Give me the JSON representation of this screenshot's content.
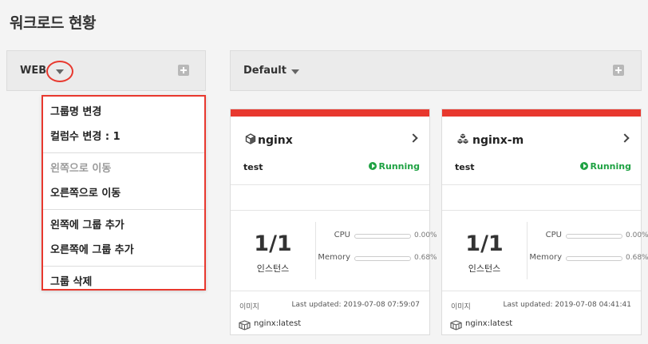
{
  "page": {
    "title": "워크로드 현황"
  },
  "groups": [
    {
      "name": "WEB"
    },
    {
      "name": "Default"
    }
  ],
  "menu": {
    "sections": [
      [
        {
          "label": "그룹명 변경",
          "disabled": false
        },
        {
          "label": "컬럼수 변경 : 1",
          "disabled": false
        }
      ],
      [
        {
          "label": "왼쪽으로 이동",
          "disabled": true
        },
        {
          "label": "오른쪽으로 이동",
          "disabled": false
        }
      ],
      [
        {
          "label": "왼쪽에 그룹 추가",
          "disabled": false
        },
        {
          "label": "오른쪽에 그룹 추가",
          "disabled": false
        }
      ],
      [
        {
          "label": "그룹 삭제",
          "disabled": false
        }
      ]
    ]
  },
  "cards": [
    {
      "name": "nginx",
      "icon": "cube-icon",
      "sub": "test",
      "status": "Running",
      "count": "1/1",
      "count_label": "인스턴스",
      "cpu_label": "CPU",
      "cpu_value": "0.00%",
      "mem_label": "Memory",
      "mem_value": "0.68%",
      "image_label": "이미지",
      "updated": "Last updated: 2019-07-08 07:59:07",
      "image": "nginx:latest"
    },
    {
      "name": "nginx-m",
      "icon": "cubes-icon",
      "sub": "test",
      "status": "Running",
      "count": "1/1",
      "count_label": "인스턴스",
      "cpu_label": "CPU",
      "cpu_value": "0.00%",
      "mem_label": "Memory",
      "mem_value": "0.68%",
      "image_label": "이미지",
      "updated": "Last updated: 2019-07-08 04:41:41",
      "image": "nginx:latest"
    }
  ],
  "colors": {
    "accent": "#e8382e",
    "running": "#1fa243"
  }
}
